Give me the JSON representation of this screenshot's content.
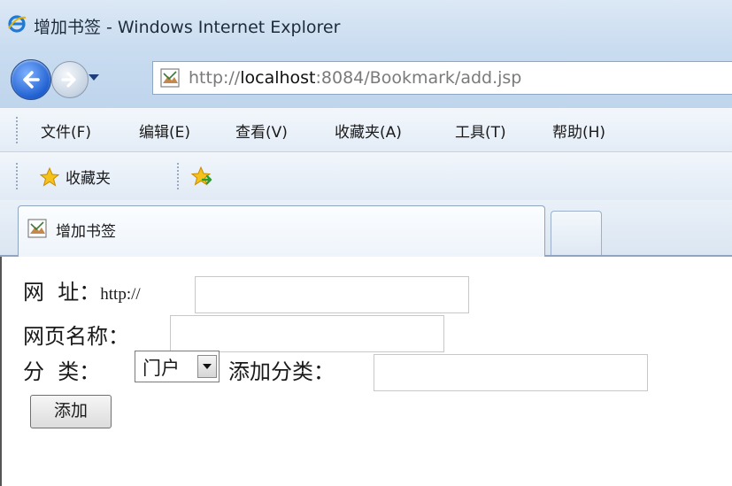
{
  "window": {
    "title": "增加书签 - Windows Internet Explorer"
  },
  "address_bar": {
    "url_prefix": "http://",
    "url_host": "localhost",
    "url_rest": ":8084/Bookmark/add.jsp"
  },
  "menu": {
    "items": [
      "文件(F)",
      "编辑(E)",
      "查看(V)",
      "收藏夹(A)",
      "工具(T)",
      "帮助(H)"
    ]
  },
  "favorites_bar": {
    "label": "收藏夹"
  },
  "tabs": [
    {
      "label": "增加书签",
      "active": true
    }
  ],
  "form": {
    "url_label": "网  址：",
    "url_prefix": "http://",
    "url_value": "",
    "name_label": "网页名称：",
    "name_value": "",
    "category_label": "分  类：",
    "category_selected": "门户",
    "add_category_label": "添加分类：",
    "add_category_value": "",
    "submit_label": "添加"
  },
  "icons": {
    "browser": "ie-logo-icon",
    "back": "back-arrow-icon",
    "forward": "forward-arrow-icon",
    "favicon": "page-favicon-icon",
    "favorites": "star-icon",
    "add_favorite": "add-favorite-icon"
  }
}
